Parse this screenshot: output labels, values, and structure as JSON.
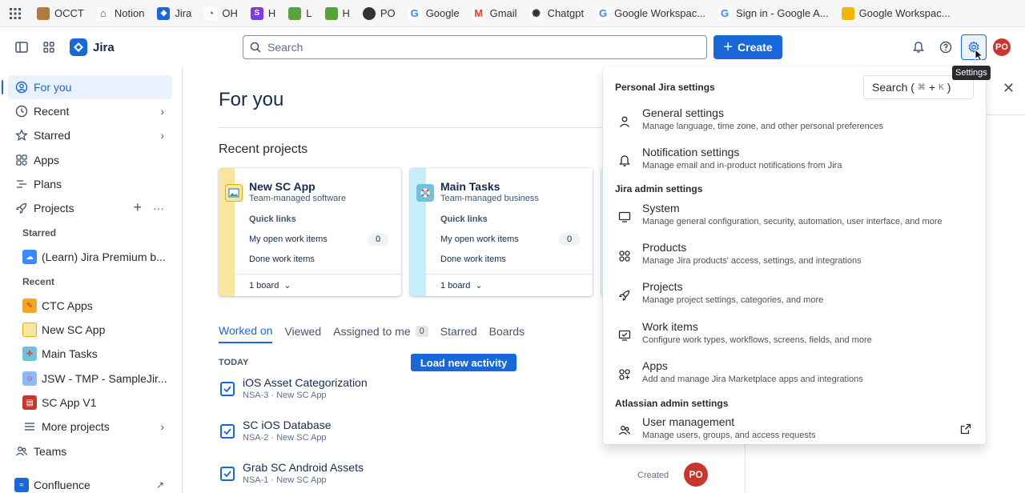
{
  "bookmarks": [
    {
      "label": "OCCT",
      "color": "#b07b3c",
      "glyph": ""
    },
    {
      "label": "Notion",
      "color": "#ffffff",
      "glyph": ""
    },
    {
      "label": "Jira",
      "color": "#1868db",
      "glyph": ""
    },
    {
      "label": "OH",
      "color": "#6b3df0",
      "glyph": ""
    },
    {
      "label": "H",
      "color": "#7c3aed",
      "glyph": "S"
    },
    {
      "label": "L",
      "color": "#5aa33c",
      "glyph": ""
    },
    {
      "label": "H",
      "color": "#5aa33c",
      "glyph": ""
    },
    {
      "label": "PO",
      "color": "#333333",
      "glyph": ""
    },
    {
      "label": "Google",
      "color": "#ffffff",
      "glyph": "G"
    },
    {
      "label": "Gmail",
      "color": "#ffffff",
      "glyph": "M"
    },
    {
      "label": "Chatgpt",
      "color": "#ffffff",
      "glyph": ""
    },
    {
      "label": "Google Workspac...",
      "color": "#ffffff",
      "glyph": "G"
    },
    {
      "label": "Sign in - Google A...",
      "color": "#ffffff",
      "glyph": "G"
    },
    {
      "label": "Google Workspac...",
      "color": "#f4b400",
      "glyph": ""
    }
  ],
  "topnav": {
    "app_name": "Jira",
    "search_placeholder": "Search",
    "create_label": "Create",
    "avatar_initials": "PO",
    "settings_tooltip": "Settings"
  },
  "sidebar": {
    "for_you": "For you",
    "recent": "Recent",
    "starred": "Starred",
    "apps": "Apps",
    "plans": "Plans",
    "projects": "Projects",
    "starred_header": "Starred",
    "starred_project": "(Learn) Jira Premium b...",
    "recent_header": "Recent",
    "recent_projects": [
      "CTC Apps",
      "New SC App",
      "Main Tasks",
      "JSW - TMP - SampleJir...",
      "SC App V1"
    ],
    "more_projects": "More projects",
    "teams": "Teams",
    "confluence": "Confluence"
  },
  "main": {
    "title": "For you",
    "recent_projects_title": "Recent projects",
    "cards": [
      {
        "name": "New SC App",
        "type": "Team-managed software",
        "quick_links": "Quick links",
        "open_items": "My open work items",
        "count": "0",
        "done": "Done work items",
        "board": "1 board",
        "stripe": "#f8e6a0"
      },
      {
        "name": "Main Tasks",
        "type": "Team-managed business",
        "quick_links": "Quick links",
        "open_items": "My open work items",
        "count": "0",
        "done": "Done work items",
        "board": "1 board",
        "stripe": "#c6edfb"
      }
    ],
    "tabs": [
      "Worked on",
      "Viewed",
      "Assigned to me",
      "Starred",
      "Boards"
    ],
    "assigned_count": "0",
    "today": "TODAY",
    "load_new": "Load new activity",
    "work_items": [
      {
        "title": "iOS Asset Categorization",
        "key": "NSA-3",
        "project": "New SC App"
      },
      {
        "title": "SC iOS Database",
        "key": "NSA-2",
        "project": "New SC App"
      },
      {
        "title": "Grab SC Android Assets",
        "key": "NSA-1",
        "project": "New SC App",
        "action": "Created",
        "avatar": "PO"
      }
    ]
  },
  "settings_menu": {
    "personal_header": "Personal Jira settings",
    "search_label": "Search (",
    "search_kbd1": "⌘",
    "search_plus": "+",
    "search_kbd2": "K",
    "search_close": ")",
    "personal_items": [
      {
        "title": "General settings",
        "desc": "Manage language, time zone, and other personal preferences"
      },
      {
        "title": "Notification settings",
        "desc": "Manage email and in-product notifications from Jira"
      }
    ],
    "admin_header": "Jira admin settings",
    "admin_items": [
      {
        "title": "System",
        "desc": "Manage general configuration, security, automation, user interface, and more"
      },
      {
        "title": "Products",
        "desc": "Manage Jira products' access, settings, and integrations"
      },
      {
        "title": "Projects",
        "desc": "Manage project settings, categories, and more"
      },
      {
        "title": "Work items",
        "desc": "Configure work types, workflows, screens, fields, and more"
      },
      {
        "title": "Apps",
        "desc": "Add and manage Jira Marketplace apps and integrations"
      }
    ],
    "atlassian_header": "Atlassian admin settings",
    "atlassian_items": [
      {
        "title": "User management",
        "desc": "Manage users, groups, and access requests"
      }
    ]
  },
  "colors": {
    "brand": "#1868db",
    "avatar": "#c9372c"
  }
}
